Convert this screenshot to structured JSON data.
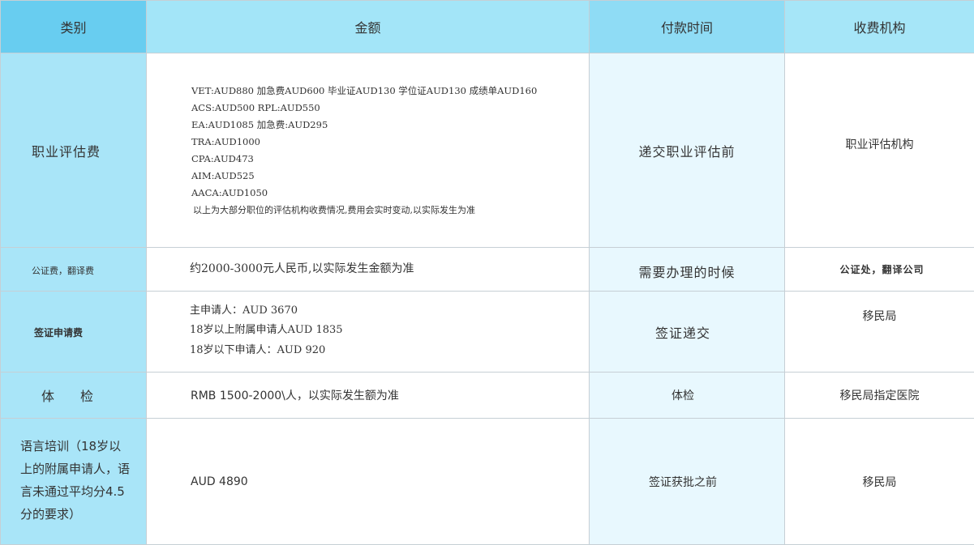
{
  "headers": {
    "category": "类别",
    "amount": "金额",
    "payment_time": "付款时间",
    "agency": "收费机构"
  },
  "rows": [
    {
      "category": "职业评估费",
      "amount_lines": [
        "VET:AUD880 加急费AUD600 毕业证AUD130 学位证AUD130 成绩单AUD160",
        "ACS:AUD500 RPL:AUD550",
        "EA:AUD1085 加急费:AUD295",
        "TRA:AUD1000",
        "CPA:AUD473",
        "AIM:AUD525",
        "AACA:AUD1050",
        "以上为大部分职位的评估机构收费情况,费用会实时变动,以实际发生为准"
      ],
      "payment_time": "递交职业评估前",
      "agency": "职业评估机构"
    },
    {
      "category": "公证费，翻译费",
      "amount_lines": [
        "约2000-3000元人民币,以实际发生金额为准"
      ],
      "payment_time": "需要办理的时候",
      "agency": "公证处，翻译公司"
    },
    {
      "category": "签证申请费",
      "amount_lines": [
        "主申请人：AUD 3670",
        "18岁以上附属申请人AUD 1835",
        "18岁以下申请人：AUD 920"
      ],
      "payment_time": "签证递交",
      "agency": "移民局"
    },
    {
      "category": "体　　检",
      "amount_lines": [
        "RMB 1500-2000\\人，以实际发生额为准"
      ],
      "payment_time": "体检",
      "agency": "移民局指定医院"
    },
    {
      "category": "语言培训（18岁以上的附属申请人，语言未通过平均分4.5分的要求）",
      "amount_lines": [
        "AUD 4890"
      ],
      "payment_time": "签证获批之前",
      "agency": "移民局"
    }
  ]
}
